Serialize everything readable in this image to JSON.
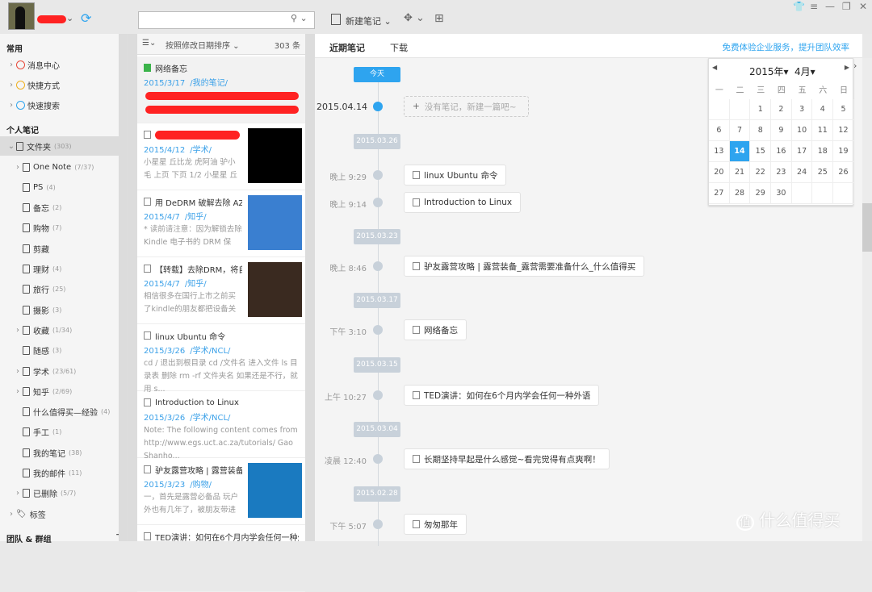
{
  "header": {
    "search_placeholder": "",
    "new_note_label": "新建笔记"
  },
  "sidebar": {
    "common_heading": "常用",
    "common": [
      {
        "label": "消息中心",
        "icon": "message-center-icon",
        "color": "#e84a3a"
      },
      {
        "label": "快捷方式",
        "icon": "shortcut-icon",
        "color": "#f0b020"
      },
      {
        "label": "快速搜索",
        "icon": "quick-search-icon",
        "color": "#2ea4ef"
      }
    ],
    "personal_heading": "个人笔记",
    "root": {
      "label": "文件夹",
      "count": "(303)"
    },
    "folders": [
      {
        "label": "One Note",
        "count": "(7/37)",
        "expandable": true
      },
      {
        "label": "PS",
        "count": "(4)"
      },
      {
        "label": "备忘",
        "count": "(2)"
      },
      {
        "label": "购物",
        "count": "(7)"
      },
      {
        "label": "剪藏",
        "count": ""
      },
      {
        "label": "理财",
        "count": "(4)"
      },
      {
        "label": "旅行",
        "count": "(25)"
      },
      {
        "label": "摄影",
        "count": "(3)"
      },
      {
        "label": "收藏",
        "count": "(1/34)",
        "expandable": true
      },
      {
        "label": "随感",
        "count": "(3)"
      },
      {
        "label": "学术",
        "count": "(23/61)",
        "expandable": true
      },
      {
        "label": "知乎",
        "count": "(2/69)",
        "expandable": true
      },
      {
        "label": "什么值得买—经验",
        "count": "(4)"
      },
      {
        "label": "手工",
        "count": "(1)"
      },
      {
        "label": "我的笔记",
        "count": "(38)"
      },
      {
        "label": "我的邮件",
        "count": "(11)"
      },
      {
        "label": "已删除",
        "count": "(5/7)",
        "expandable": true
      }
    ],
    "tags_label": "标签",
    "team_heading": "团队 & 群组"
  },
  "notelist": {
    "sort_label": "按照修改日期排序",
    "count": "303 条",
    "notes": [
      {
        "title": "网络备忘",
        "date": "2015/3/17",
        "path": "/我的笔记/",
        "snippet": ""
      },
      {
        "title": "",
        "date": "2015/4/12",
        "path": "/学术/",
        "snippet": "小星星 丘比龙 虎阿油 驴小毛 上页 下页 1/2 小星星 丘比龙..."
      },
      {
        "title": "用 DeDRM 破解去除 AZ...",
        "date": "2015/4/7",
        "path": "/知乎/",
        "snippet": "* 读前请注意：因为解锁去除 Kindle 电子书的 DRM 保护..."
      },
      {
        "title": "【转载】去除DRM，将自...",
        "date": "2015/4/7",
        "path": "/知乎/",
        "snippet": "相信很多在国行上市之前买了kindle的朋友都把设备关联了..."
      },
      {
        "title": "linux Ubuntu 命令",
        "date": "2015/3/26",
        "path": "/学术/NCL/",
        "snippet": "cd / 退出到根目录 cd /文件名 进入文件 ls 目录表 删除 rm -rf 文件夹名 如果还是不行，就用 s..."
      },
      {
        "title": "Introduction to Linux",
        "date": "2015/3/26",
        "path": "/学术/NCL/",
        "snippet": "Note: The following content comes from http://www.egs.uct.ac.za/tutorials/ Gao Shanho..."
      },
      {
        "title": "驴友露营攻略 | 露营装备_...",
        "date": "2015/3/23",
        "path": "/购物/",
        "snippet": "一，首先是露营必备品 玩户外也有几年了，被朋友带进户外..."
      },
      {
        "title": "TED演讲：如何在6个月内学会任何一种外语",
        "date": "",
        "path": "",
        "snippet": ""
      }
    ]
  },
  "main": {
    "tabs": [
      "近期笔记",
      "下载"
    ],
    "promo": "免费体验企业服务，提升团队效率",
    "today_label": "今天",
    "today_date": "2015.04.14",
    "empty_prompt": "没有笔记，新建一篇吧~",
    "timeline": [
      {
        "type": "date",
        "label": "2015.03.26"
      },
      {
        "type": "note",
        "time": "晚上 9:29",
        "title": "linux Ubuntu 命令"
      },
      {
        "type": "note",
        "time": "晚上 9:14",
        "title": "Introduction to Linux"
      },
      {
        "type": "date",
        "label": "2015.03.23"
      },
      {
        "type": "note",
        "time": "晚上 8:46",
        "title": "驴友露营攻略 | 露营装备_露营需要准备什么_什么值得买"
      },
      {
        "type": "date",
        "label": "2015.03.17"
      },
      {
        "type": "note",
        "time": "下午 3:10",
        "title": "网络备忘"
      },
      {
        "type": "date",
        "label": "2015.03.15"
      },
      {
        "type": "note",
        "time": "上午 10:27",
        "title": "TED演讲：如何在6个月内学会任何一种外语"
      },
      {
        "type": "date",
        "label": "2015.03.04"
      },
      {
        "type": "note",
        "time": "凌晨 12:40",
        "title": "长期坚持早起是什么感觉~看完觉得有点爽啊！"
      },
      {
        "type": "date",
        "label": "2015.02.28"
      },
      {
        "type": "note",
        "time": "下午 5:07",
        "title": "匆匆那年"
      }
    ]
  },
  "calendar": {
    "year": "2015年",
    "month": "4月",
    "weekdays": [
      "一",
      "二",
      "三",
      "四",
      "五",
      "六",
      "日"
    ],
    "days": [
      "",
      "",
      "1",
      "2",
      "3",
      "4",
      "5",
      "6",
      "7",
      "8",
      "9",
      "10",
      "11",
      "12",
      "13",
      "14",
      "15",
      "16",
      "17",
      "18",
      "19",
      "20",
      "21",
      "22",
      "23",
      "24",
      "25",
      "26",
      "27",
      "28",
      "29",
      "30",
      "",
      "",
      ""
    ],
    "selected": "14"
  },
  "watermark": "什么值得买",
  "colors": {
    "accent": "#2ea4ef"
  }
}
